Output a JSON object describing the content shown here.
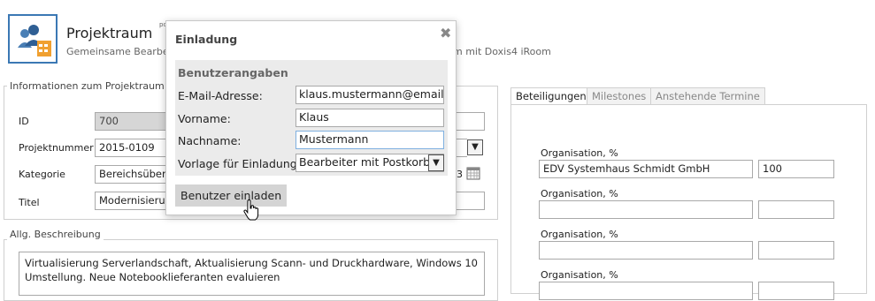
{
  "header": {
    "title": "Projektraum",
    "superscript": "po",
    "subtitle_start": "Gemeinsame Bearbe",
    "subtitle_end": "m mit Doxis4 iRoom",
    "icon": "project-room-icon"
  },
  "info_section": {
    "legend": "Informationen zum Projektraum",
    "fields": [
      {
        "label": "ID",
        "value": "700"
      },
      {
        "label": "Projektnummer",
        "value": "2015-0109"
      },
      {
        "label": "Kategorie",
        "value": "Bereichsüberg"
      },
      {
        "label": "Titel",
        "value": "Modernisierun"
      }
    ],
    "date_suffix": "3"
  },
  "description": {
    "legend": "Allg. Beschreibung",
    "text_line1": "Virtualisierung Serverlandschaft, Aktualisierung Scann- und Druckhardware, Windows 10",
    "text_line2": "Umstellung. Neue Notebooklieferanten evaluieren"
  },
  "tabs": [
    {
      "label": "Beteiligungen",
      "active": true
    },
    {
      "label": "Milestones",
      "active": false
    },
    {
      "label": "Anstehende Termine",
      "active": false
    }
  ],
  "participations": [
    {
      "label": "Organisation, %",
      "organisation": "EDV Systemhaus Schmidt GmbH",
      "percent": "100"
    },
    {
      "label": "Organisation, %",
      "organisation": "",
      "percent": ""
    },
    {
      "label": "Organisation, %",
      "organisation": "",
      "percent": ""
    },
    {
      "label": "Organisation, %",
      "organisation": "",
      "percent": ""
    }
  ],
  "modal": {
    "title": "Einladung",
    "close_icon": "close-icon",
    "section_title": "Benutzerangaben",
    "email_label": "E-Mail-Adresse:",
    "email_value": "klaus.mustermann@email.de",
    "firstname_label": "Vorname:",
    "firstname_value": "Klaus",
    "lastname_label": "Nachname:",
    "lastname_value": "Mustermann",
    "template_label": "Vorlage für Einladung:",
    "template_value": "Bearbeiter mit Postkorb",
    "invite_button": "Benutzer einladen"
  },
  "colors": {
    "accent": "#3b78b4",
    "disabled_field": "#d6d6d6",
    "modal_section": "#ebebeb"
  }
}
